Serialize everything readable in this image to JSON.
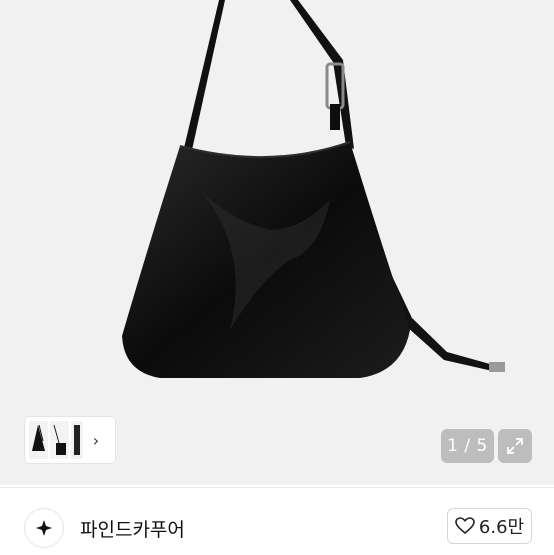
{
  "gallery": {
    "counter": "1 / 5",
    "thumbnail_next_icon": "chevron-right-icon",
    "expand_icon": "expand-arrows-icon"
  },
  "seller": {
    "name": "파인드카푸어",
    "avatar_icon": "star-logo-icon"
  },
  "like": {
    "icon": "heart-icon",
    "count": "6.6만"
  },
  "colors": {
    "image_bg": "#f1f1f1",
    "overlay": "#bdbdbd",
    "bag": "#0d0d0d"
  }
}
